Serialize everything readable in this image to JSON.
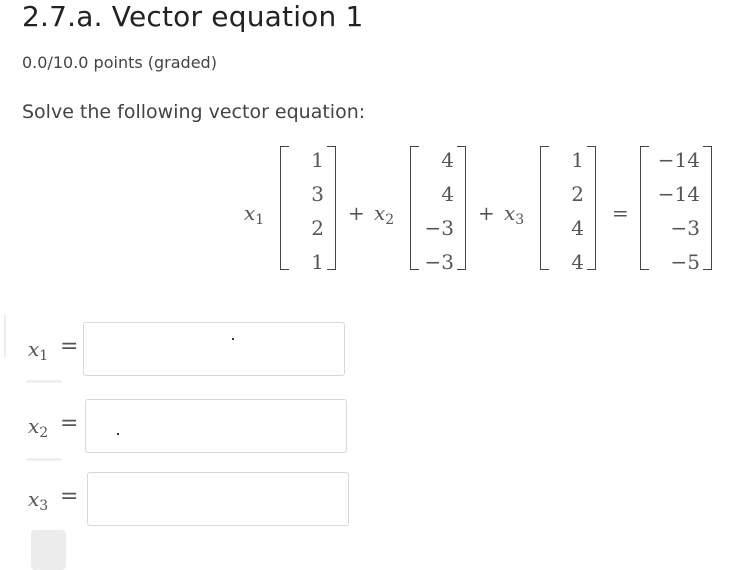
{
  "header": {
    "title": "2.7.a. Vector equation 1",
    "points": "0.0/10.0 points (graded)"
  },
  "problem": {
    "prompt": "Solve the following vector equation:",
    "coef_var": "x",
    "coef_subs": [
      "1",
      "2",
      "3"
    ],
    "plus": "+",
    "equals": "=",
    "vectors": [
      [
        "1",
        "3",
        "2",
        "1"
      ],
      [
        "4",
        "4",
        "−3",
        "−3"
      ],
      [
        "1",
        "2",
        "4",
        "4"
      ]
    ],
    "rhs": [
      "−14",
      "−14",
      "−3",
      "−5"
    ]
  },
  "answers": [
    {
      "var": "x",
      "sub": "1",
      "eq": "=",
      "value": ""
    },
    {
      "var": "x",
      "sub": "2",
      "eq": "=",
      "value": ""
    },
    {
      "var": "x",
      "sub": "3",
      "eq": "=",
      "value": ""
    }
  ]
}
